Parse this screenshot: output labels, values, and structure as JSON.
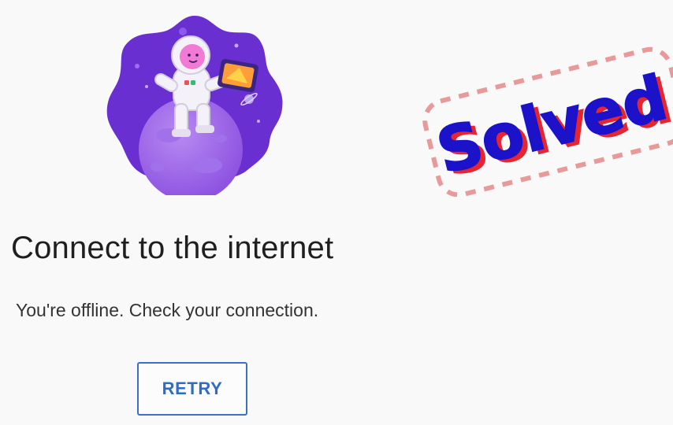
{
  "illustration": {
    "icon": "astronaut-on-planet-illustration"
  },
  "heading": "Connect to the internet",
  "message": "You're offline. Check your connection.",
  "retry_label": "RETRY",
  "stamp": {
    "text": "Solved",
    "text_color": "#1b12c9",
    "shadow_color": "#e8242e",
    "border_color": "#e89a9a"
  },
  "colors": {
    "background": "#f9f9f9",
    "accent": "#2f6bc7",
    "illustration_purple": "#6a2fd1"
  }
}
